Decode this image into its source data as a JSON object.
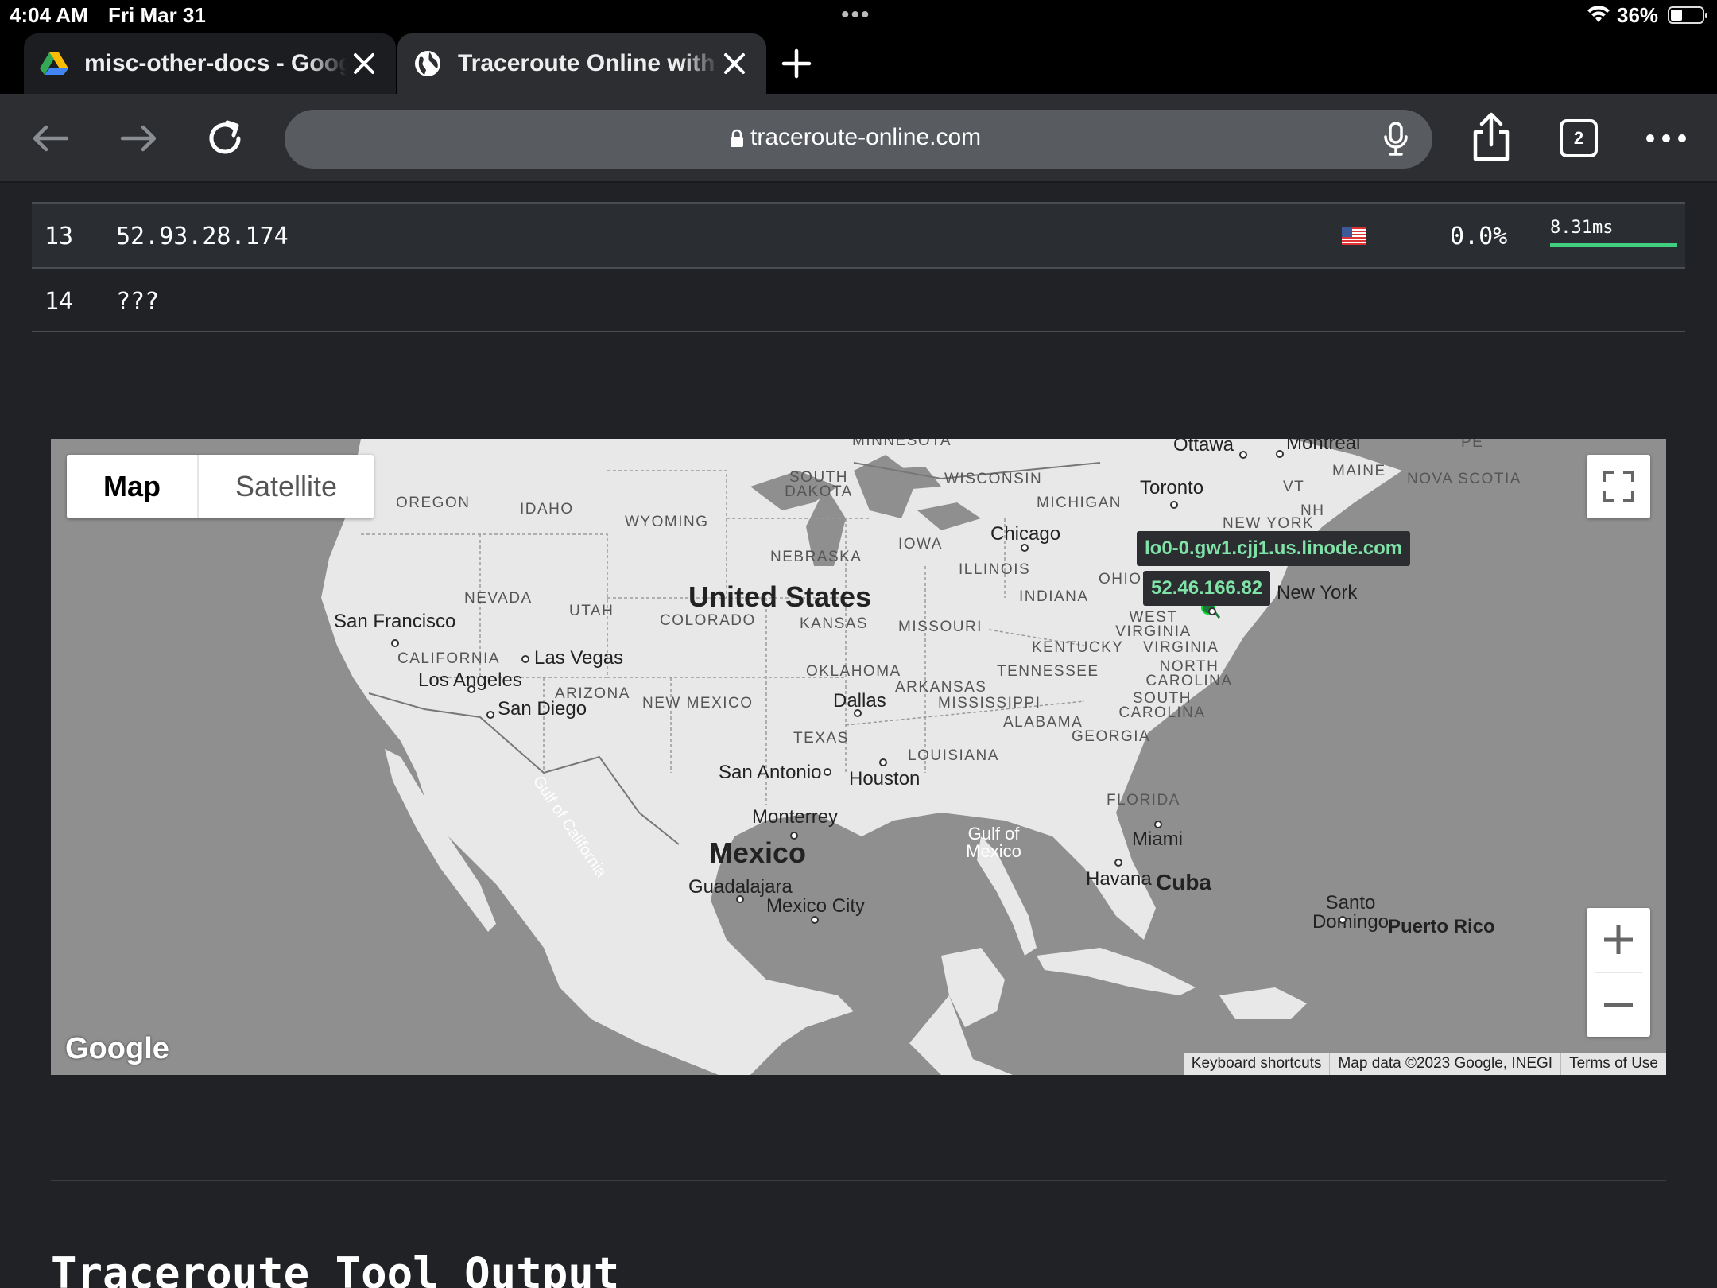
{
  "status_bar": {
    "time": "4:04 AM",
    "date": "Fri Mar 31",
    "battery": "36%"
  },
  "tabs": [
    {
      "title": "misc-other-docs - Google Drive",
      "icon": "google-drive-icon",
      "active": false
    },
    {
      "title": "Traceroute Online with Map",
      "icon": "globe-icon",
      "active": true
    }
  ],
  "toolbar": {
    "url": "traceroute-online.com",
    "tab_count": "2"
  },
  "hops": [
    {
      "num": "13",
      "ip": "52.93.28.174",
      "country": "US",
      "loss": "0.0%",
      "rtt": "8.31ms",
      "rtt_fill": 1.0
    },
    {
      "num": "14",
      "ip": "???",
      "country": "",
      "loss": "",
      "rtt": ""
    }
  ],
  "map": {
    "type_buttons": {
      "map": "Map",
      "satellite": "Satellite"
    },
    "tooltips": {
      "host": "lo0-0.gw1.cjj1.us.linode.com",
      "ip": "52.46.166.82"
    },
    "labels": {
      "minnesota": "MINNESOTA",
      "south_dakota": "SOUTH DAKOTA",
      "wisconsin": "WISCONSIN",
      "michigan": "MICHIGAN",
      "oregon": "OREGON",
      "idaho": "IDAHO",
      "wyoming": "WYOMING",
      "nebraska": "NEBRASKA",
      "iowa": "IOWA",
      "illinois": "ILLINOIS",
      "indiana": "INDIANA",
      "ohio": "OHIO",
      "nevada": "NEVADA",
      "utah": "UTAH",
      "colorado": "COLORADO",
      "kansas": "KANSAS",
      "missouri": "MISSOURI",
      "kentucky": "KENTUCKY",
      "west_virginia": "WEST VIRGINIA",
      "virginia": "VIRGINIA",
      "california": "CALIFORNIA",
      "oklahoma": "OKLAHOMA",
      "tennessee": "TENNESSEE",
      "north_carolina": "NORTH CAROLINA",
      "arizona": "ARIZONA",
      "new_mexico": "NEW MEXICO",
      "arkansas": "ARKANSAS",
      "mississippi": "MISSISSIPPI",
      "south_carolina": "SOUTH CAROLINA",
      "alabama": "ALABAMA",
      "georgia": "GEORGIA",
      "texas": "TEXAS",
      "louisiana": "LOUISIANA",
      "florida": "FLORIDA",
      "maine": "MAINE",
      "vt": "VT",
      "nh": "NH",
      "new_york_state": "NEW YORK",
      "nova_scotia": "NOVA SCOTIA",
      "pe": "PE",
      "ottawa": "Ottawa",
      "montreal": "Montreal",
      "toronto": "Toronto",
      "chicago": "Chicago",
      "new_york": "New York",
      "united_states": "United States",
      "san_francisco": "San Francisco",
      "las_vegas": "Las Vegas",
      "los_angeles": "Los Angeles",
      "san_diego": "San Diego",
      "dallas": "Dallas",
      "san_antonio": "San Antonio",
      "houston": "Houston",
      "monterrey": "Monterrey",
      "mexico": "Mexico",
      "guadalajara": "Guadalajara",
      "mexico_city": "Mexico City",
      "miami": "Miami",
      "havana": "Havana",
      "cuba": "Cuba",
      "santo_domingo": "Santo Domingo",
      "puerto_rico": "Puerto Rico",
      "gulf_of_mexico": "Gulf of Mexico",
      "gulf_of_california": "Gulf of California"
    },
    "footer": {
      "logo": "Google",
      "shortcuts": "Keyboard shortcuts",
      "data": "Map data ©2023 Google, INEGI",
      "terms": "Terms of Use"
    },
    "colors": {
      "water": "#8f8f8f",
      "land": "#e8e8e8",
      "tooltip_text": "#7fe3a8"
    }
  },
  "section_title": "Traceroute Tool Output"
}
